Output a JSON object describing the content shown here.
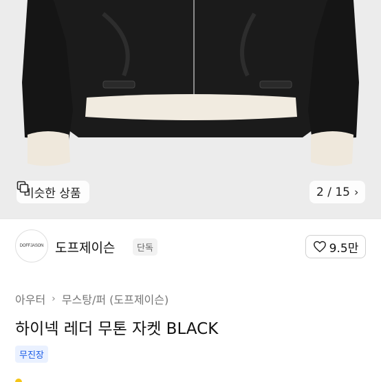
{
  "product_image": {
    "similar_button_label": "비슷한 상품",
    "similar_icon": "similar-items-icon",
    "pager_text": "2 / 15",
    "pager_icon": "chevron-right-icon"
  },
  "brand": {
    "logo_text": "DOFFJASON",
    "name": "도프제이슨",
    "badge": "단독",
    "like_icon": "heart-icon",
    "like_count": "9.5만"
  },
  "breadcrumb": {
    "category": "아우터",
    "separator_icon": "chevron-right-icon",
    "subcategory": "무스탕/퍼 (도프제이슨)"
  },
  "product": {
    "title": "하이넥 레더 무톤 자켓 BLACK",
    "tag": "무진장"
  },
  "colors": {
    "accent_blue": "#1a5be6",
    "tag_bg": "#eaf1ff",
    "hero_bg": "#ececec"
  }
}
